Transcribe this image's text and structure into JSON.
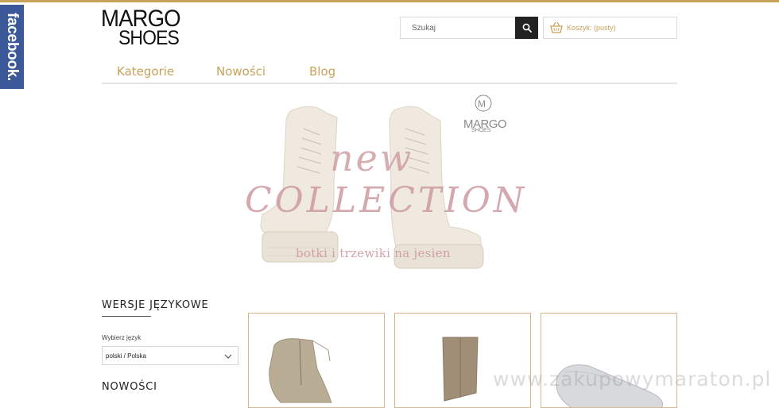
{
  "facebook_tab": {
    "label": "facebook."
  },
  "logo": {
    "line1": "MARGO",
    "line2": "SHOES"
  },
  "search": {
    "placeholder": "Szukaj",
    "icon": "search-icon"
  },
  "cart": {
    "label": "Koszyk: (pusty)",
    "icon": "basket-icon"
  },
  "nav": {
    "items": [
      {
        "label": "Kategorie"
      },
      {
        "label": "Nowości"
      },
      {
        "label": "Blog"
      }
    ]
  },
  "banner": {
    "brand_line1": "MARGO",
    "brand_line2": "SHOES",
    "headline_1": "new",
    "headline_2": "COLLECTION",
    "subtitle": "botki i trzewiki na jesien"
  },
  "sidebar": {
    "languages_title": "WERSJE JĘZYKOWE",
    "select_label": "Wybierz język",
    "selected_language": "polski / Polska",
    "news_title": "NOWOŚCI"
  },
  "products": [
    {
      "name": "beige suede ankle boot"
    },
    {
      "name": "taupe knee boot"
    },
    {
      "name": "silver slip-on shoe"
    }
  ],
  "watermark": "www.zakupowymaraton.pl",
  "colors": {
    "accent": "#c9a25a",
    "facebook": "#3b5998",
    "banner_text": "#cd9aa0"
  }
}
